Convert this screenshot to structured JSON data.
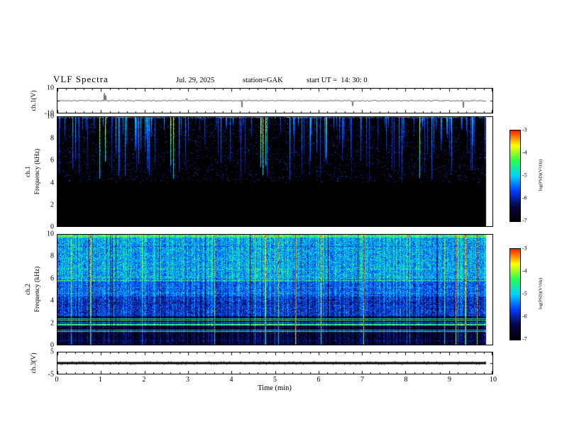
{
  "header": {
    "title": "VLF Spectra",
    "date": "Jul. 29, 2025",
    "station": "station=GAK",
    "start_ut": "start UT =  14: 30: 0"
  },
  "axes": {
    "time_label": "Time (min)",
    "time_ticks": [
      0,
      1,
      2,
      3,
      4,
      5,
      6,
      7,
      8,
      9,
      10
    ],
    "time_range_min": [
      0,
      10
    ],
    "data_end_min": 9.85
  },
  "panels": {
    "wave": {
      "ylabel": "ch.1(V)",
      "yticks": [
        10,
        -10
      ],
      "ylim": [
        -10,
        10
      ]
    },
    "spec1": {
      "channel": "ch.1",
      "axis_label": "Frequency (kHz)",
      "yticks": [
        0,
        2,
        4,
        6,
        8,
        10
      ],
      "ylim_khz": [
        0,
        10
      ]
    },
    "spec2": {
      "channel": "ch.2",
      "axis_label": "Frequency (kHz)",
      "yticks": [
        0,
        2,
        4,
        6,
        8,
        10
      ],
      "ylim_khz": [
        0,
        10
      ]
    },
    "ch3": {
      "ylabel": "ch.3(V)",
      "yticks": [
        5,
        -5
      ],
      "ylim": [
        -5,
        5
      ]
    }
  },
  "colorbar": {
    "label": "log(PSD)(V²/Hz)",
    "ticks": [
      -3,
      -4,
      -5,
      -6,
      -7
    ],
    "range": [
      -3,
      -7
    ],
    "colors": [
      "#ff1e00",
      "#ffff00",
      "#28ff50",
      "#00d2ff",
      "#003cff",
      "#050546",
      "#000000"
    ]
  },
  "chart_data": [
    {
      "type": "line",
      "name": "ch.1 voltage waveform",
      "xlabel": "Time (min)",
      "xlim": [
        0,
        10
      ],
      "ylabel": "ch.1(V)",
      "ylim": [
        -10,
        10
      ],
      "description": "Near-zero noisy trace with sparse small impulsive spikes, data spans 0 to ~9.85 min"
    },
    {
      "type": "heatmap",
      "name": "ch.1 spectrogram",
      "xlabel": "Time (min)",
      "xlim": [
        0,
        10
      ],
      "ylabel": "Frequency (kHz)",
      "ylim": [
        0,
        10
      ],
      "zlabel": "log(PSD)(V²/Hz)",
      "zlim": [
        -7,
        -3
      ],
      "description": "Background at noise floor (~-7, black). Sparse vertical sferic streaks descend from 10 kHz to ~4-6 kHz, mostly blue (~-6 to -5.5), occasional brighter green streaks (~-5 to -4.5). Band below ~4 kHz essentially empty/black."
    },
    {
      "type": "heatmap",
      "name": "ch.2 spectrogram",
      "xlabel": "Time (min)",
      "xlim": [
        0,
        10
      ],
      "ylabel": "Frequency (kHz)",
      "ylim": [
        0,
        10
      ],
      "zlabel": "log(PSD)(V²/Hz)",
      "zlim": [
        -7,
        -3
      ],
      "description": "Broadband activity: dense cyan/green speckle (~-5 to -4.5) above ~5.5 kHz; blue (~-6 to -5.5) between ~2 and 5.5 kHz with many narrow horizontal interference lines; dark (~-7) below ~2 kHz crossed by discrete colored horizontal lines; occasional red/orange vertical streaks (~-3.5) spanning all frequencies."
    },
    {
      "type": "line",
      "name": "ch.3 voltage waveform",
      "xlabel": "Time (min)",
      "xlim": [
        0,
        10
      ],
      "ylabel": "ch.3(V)",
      "ylim": [
        -5,
        5
      ],
      "description": "Flat dense trace at 0 V across 0 to ~9.85 min"
    }
  ]
}
